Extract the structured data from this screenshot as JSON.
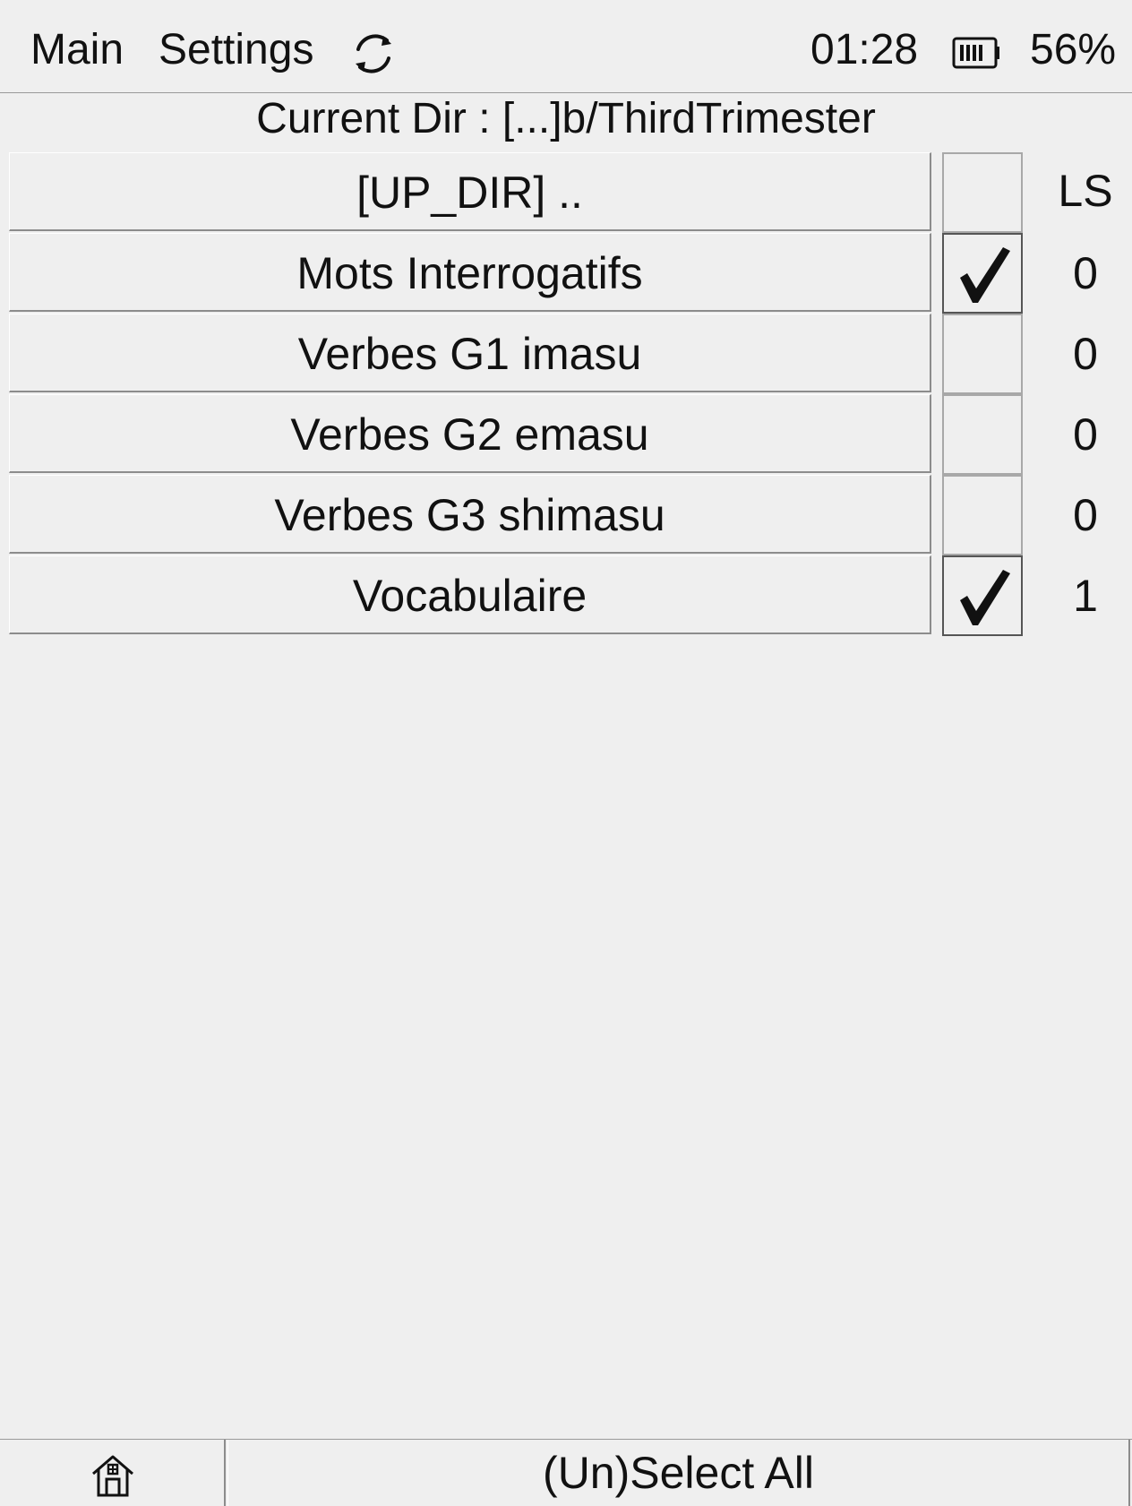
{
  "topbar": {
    "main_label": "Main",
    "settings_label": "Settings",
    "sync_icon": "sync-icon",
    "time": "01:28",
    "battery_icon": "battery-icon",
    "battery_percent": "56%"
  },
  "current_dir": {
    "text": "Current Dir : [...]b/ThirdTrimester"
  },
  "list": {
    "ls_header": "LS",
    "rows": [
      {
        "name": "[UP_DIR] ..",
        "checked": false,
        "ls": ""
      },
      {
        "name": "Mots Interrogatifs",
        "checked": true,
        "ls": "0"
      },
      {
        "name": "Verbes G1 imasu",
        "checked": false,
        "ls": "0"
      },
      {
        "name": "Verbes G2 emasu",
        "checked": false,
        "ls": "0"
      },
      {
        "name": "Verbes G3 shimasu",
        "checked": false,
        "ls": "0"
      },
      {
        "name": "Vocabulaire",
        "checked": true,
        "ls": "1"
      }
    ]
  },
  "bottombar": {
    "home_icon": "home-icon",
    "select_all_label": "(Un)Select All"
  }
}
